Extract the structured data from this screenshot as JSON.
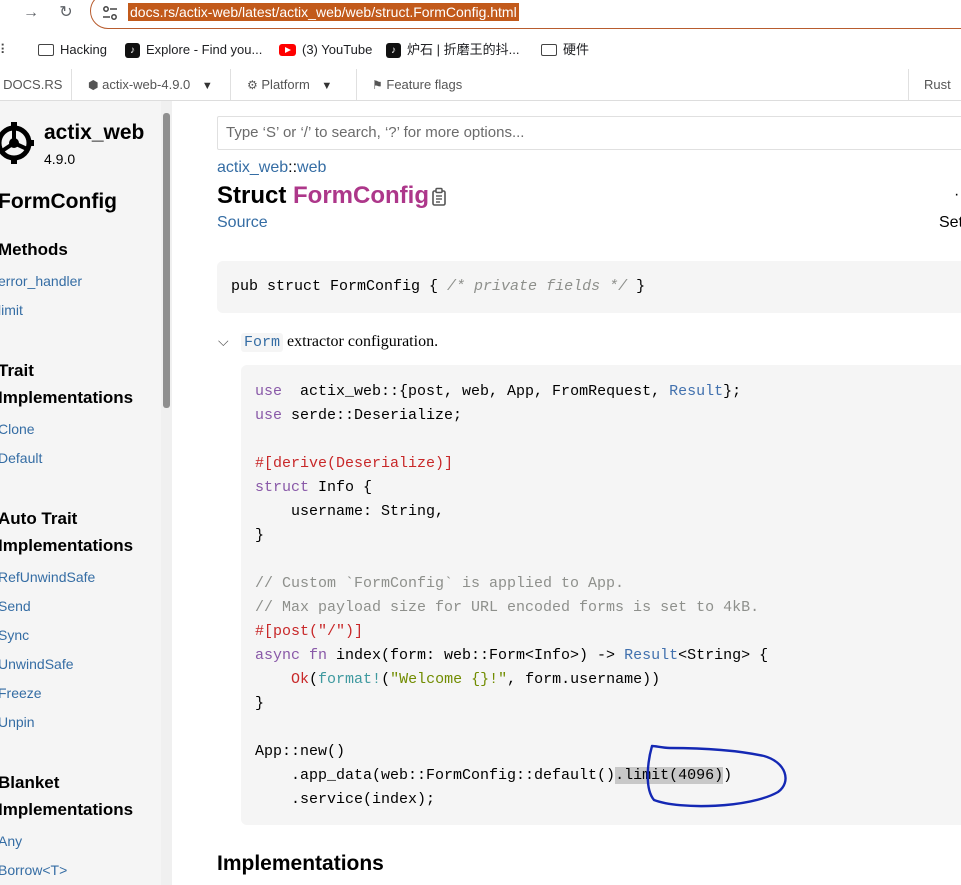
{
  "browser": {
    "url": "docs.rs/actix-web/latest/actix_web/web/struct.FormConfig.html",
    "bookmarks": [
      {
        "label": "Hacking",
        "icon": "folder-icon"
      },
      {
        "label": "Explore - Find you...",
        "icon": "tiktok-icon"
      },
      {
        "label": "(3) YouTube",
        "icon": "youtube-icon"
      },
      {
        "label": "炉石 | 折磨王的抖...",
        "icon": "tiktok-icon"
      },
      {
        "label": "硬件",
        "icon": "folder-icon"
      }
    ],
    "accent_color": "#c25a1b"
  },
  "docsnav": {
    "brand": "DOCS.RS",
    "crate": "actix-web-4.9.0",
    "platform": "Platform",
    "feature_flags": "Feature flags",
    "rust": "Rust"
  },
  "sidebar": {
    "crate_name": "actix_web",
    "version": "4.9.0",
    "item_title": "FormConfig",
    "sections": [
      {
        "title_lines": [
          "Methods"
        ],
        "links": [
          "error_handler",
          "limit"
        ]
      },
      {
        "title_lines": [
          "Trait",
          "Implementations"
        ],
        "links": [
          "Clone",
          "Default"
        ]
      },
      {
        "title_lines": [
          "Auto Trait",
          "Implementations"
        ],
        "links": [
          "RefUnwindSafe",
          "Send",
          "Sync",
          "UnwindSafe",
          "Freeze",
          "Unpin"
        ]
      },
      {
        "title_lines": [
          "Blanket",
          "Implementations"
        ],
        "links": [
          "Any",
          "Borrow<T>"
        ]
      }
    ]
  },
  "main": {
    "search_placeholder": "Type ‘S’ or ‘/’ to search, ‘?’ for more options...",
    "breadcrumb_crate": "actix_web",
    "breadcrumb_sep": "::",
    "breadcrumb_module": "web",
    "heading_kind": "Struct",
    "heading_name": "FormConfig",
    "source_link": "Source",
    "right_cut_top": "·",
    "right_cut_bottom": "Set",
    "declaration_code": "pub struct FormConfig { ",
    "declaration_comment": "/* private fields */",
    "declaration_end": " }",
    "doc_code": "Form",
    "doc_text": " extractor configuration.",
    "example_lines": [
      [
        [
          "kw",
          "use"
        ],
        [
          "",
          "  actix_web::{post, web, App, FromRequest, "
        ],
        [
          "ty",
          "Result"
        ],
        [
          "",
          "};"
        ]
      ],
      [
        [
          "kw",
          "use"
        ],
        [
          "",
          " serde::Deserialize;"
        ]
      ],
      [],
      [
        [
          "at",
          "#[derive(Deserialize)]"
        ]
      ],
      [
        [
          "kw",
          "struct"
        ],
        [
          "",
          " Info {"
        ]
      ],
      [
        [
          "",
          "    username: String,"
        ]
      ],
      [
        [
          "",
          "}"
        ]
      ],
      [],
      [
        [
          "cmt",
          "// Custom `FormConfig` is applied to App."
        ]
      ],
      [
        [
          "cmt",
          "// Max payload size for URL encoded forms is set to 4kB."
        ]
      ],
      [
        [
          "at",
          "#[post(\"/\")]"
        ]
      ],
      [
        [
          "kw",
          "async fn"
        ],
        [
          "",
          " index(form: web::Form<Info>) -> "
        ],
        [
          "ty",
          "Result"
        ],
        [
          "",
          "<String> {"
        ]
      ],
      [
        [
          "",
          "    "
        ],
        [
          "at",
          "Ok"
        ],
        [
          "",
          "("
        ],
        [
          "mc",
          "format!"
        ],
        [
          "",
          "("
        ],
        [
          "st",
          "\"Welcome {}!\""
        ],
        [
          "",
          ", form.username))"
        ]
      ],
      [
        [
          "",
          "}"
        ]
      ],
      [],
      [
        [
          "",
          "App::new()"
        ]
      ],
      [
        [
          "",
          "    .app_data(web::FormConfig::default()"
        ],
        [
          "hl",
          ".limit(4096)"
        ],
        [
          "",
          ")"
        ]
      ],
      [
        [
          "",
          "    .service(index);"
        ]
      ]
    ],
    "implementations_heading": "Implementations"
  }
}
